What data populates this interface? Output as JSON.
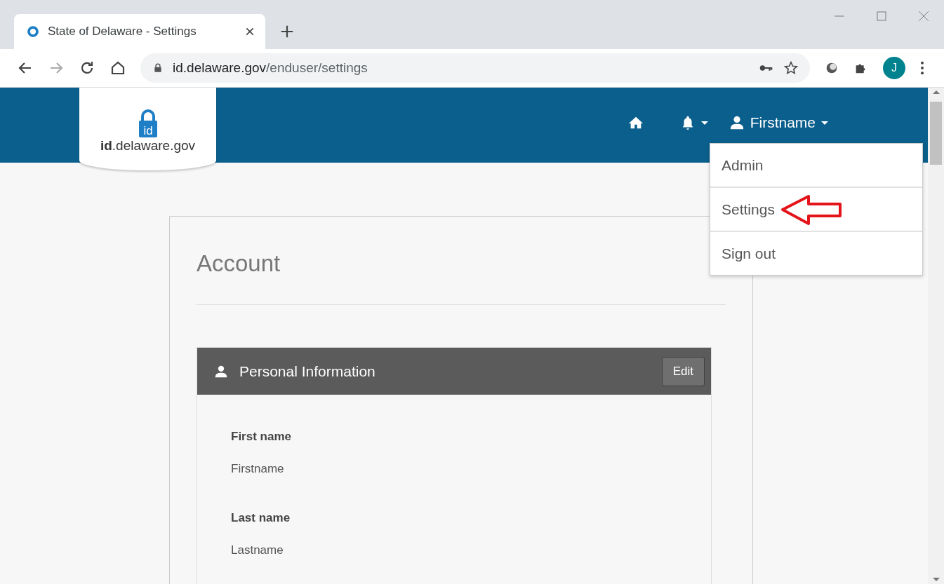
{
  "browser": {
    "tab_title": "State of Delaware - Settings",
    "url_host": "id.delaware.gov",
    "url_path": "/enduser/settings",
    "profile_initial": "J"
  },
  "header": {
    "logo_badge": "id",
    "logo_text": "**id**.delaware.gov",
    "user_name": "Firstname"
  },
  "user_menu": [
    {
      "label": "Admin",
      "highlighted": false
    },
    {
      "label": "Settings",
      "highlighted": true
    },
    {
      "label": "Sign out",
      "highlighted": false
    }
  ],
  "page_title": "Account",
  "panel": {
    "title": "Personal Information",
    "edit_button": "Edit",
    "fields": [
      {
        "label": "First name",
        "value": "Firstname"
      },
      {
        "label": "Last name",
        "value": "Lastname"
      }
    ]
  }
}
